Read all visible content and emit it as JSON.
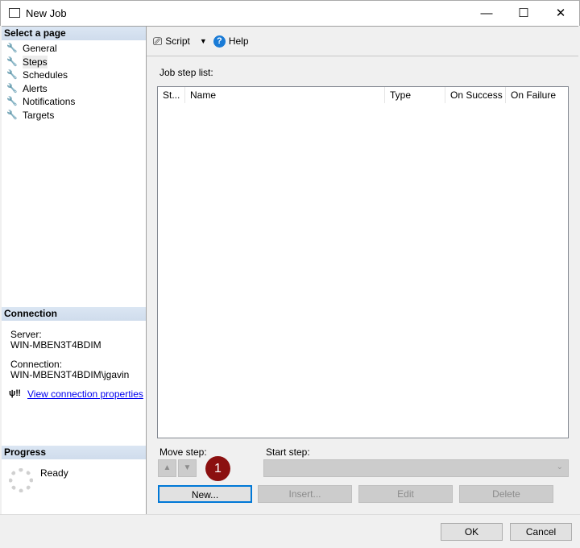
{
  "window": {
    "title": "New Job",
    "minimize": "—",
    "maximize": "☐",
    "close": "✕"
  },
  "select_page": {
    "header": "Select a page",
    "items": [
      {
        "label": "General"
      },
      {
        "label": "Steps"
      },
      {
        "label": "Schedules"
      },
      {
        "label": "Alerts"
      },
      {
        "label": "Notifications"
      },
      {
        "label": "Targets"
      }
    ]
  },
  "connection": {
    "header": "Connection",
    "server_label": "Server:",
    "server_value": "WIN-MBEN3T4BDIM",
    "connection_label": "Connection:",
    "connection_value": "WIN-MBEN3T4BDIM\\jgavin",
    "view_link": "View connection properties"
  },
  "progress": {
    "header": "Progress",
    "status": "Ready"
  },
  "toolbar": {
    "script": "Script",
    "help": "Help"
  },
  "steps": {
    "list_label": "Job step list:",
    "columns": [
      "St...",
      "Name",
      "Type",
      "On Success",
      "On Failure"
    ],
    "move_step_label": "Move step:",
    "start_step_label": "Start step:",
    "start_step_value": "",
    "badge": "1",
    "new": "New...",
    "insert": "Insert...",
    "edit": "Edit",
    "delete": "Delete"
  },
  "footer": {
    "ok": "OK",
    "cancel": "Cancel"
  },
  "colors": {
    "badge": "#8b1010",
    "link": "#0000ee",
    "header": "#d3e0ef"
  }
}
